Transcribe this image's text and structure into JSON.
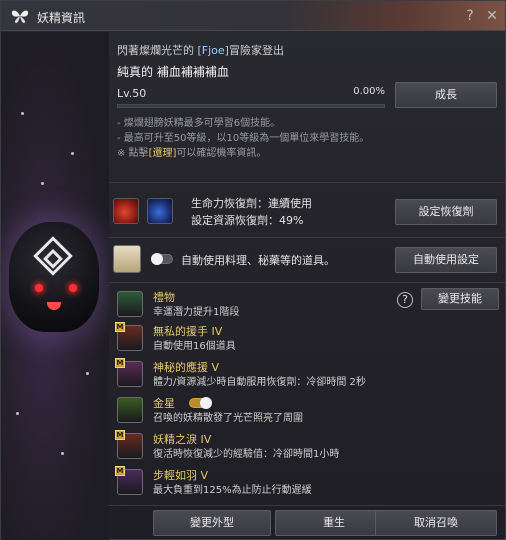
{
  "window": {
    "title": "妖精資訊",
    "help_glyph": "?",
    "close_glyph": "✕"
  },
  "header": {
    "subtitle_prefix": "閃著燦爛光芒的",
    "subtitle_tag": "[Fjoe]",
    "subtitle_suffix": "冒險家登出",
    "fairy_name": "純真的 補血補補補血",
    "level": "Lv.50",
    "exp_percent_text": "0.00%",
    "exp_fraction": 0.0,
    "grow_button": "成長"
  },
  "notes": {
    "n1": "- 燦爛翅膀妖精最多可學習6個技能。",
    "n2": "- 最高可升至50等級，以10等級為一個單位來學習技能。",
    "n3_prefix": "※ 點擊",
    "n3_link": "[還理]",
    "n3_suffix": "可以確認機率資訊。"
  },
  "potion": {
    "line1": "生命力恢復劑：連續使用",
    "line2": "設定資源恢復劑：49%",
    "button": "設定恢復劑"
  },
  "auto_use": {
    "text": "自動使用料理、秘藥等的道具。",
    "toggle_on": false,
    "button": "自動使用設定"
  },
  "skills_section": {
    "help_glyph": "?",
    "change_button": "變更技能"
  },
  "skills": [
    {
      "name": "禮物",
      "desc": "幸運潛力提升1階段",
      "badge": "",
      "icon": "clover-icon",
      "color": "#2f5a3a"
    },
    {
      "name": "無私的援手 IV",
      "desc": "自動使用16個道具",
      "badge": "M",
      "icon": "hand-icon",
      "color": "#6a2a22"
    },
    {
      "name": "神秘的應援 V",
      "desc": "體力/資源減少時自動服用恢復劑：冷卻時間 2秒",
      "badge": "M",
      "icon": "potion-icon",
      "color": "#5a2a55"
    },
    {
      "name": "金星",
      "desc": "召喚的妖精散發了光芒照亮了周圍",
      "badge": "",
      "icon": "lantern-icon",
      "color": "#3a5a22",
      "toggle_on": true
    },
    {
      "name": "妖精之淚 IV",
      "desc": "復活時恢復減少的經驗值：冷卻時間1小時",
      "badge": "M",
      "icon": "tear-icon",
      "color": "#6a2a22"
    },
    {
      "name": "步輕如羽 V",
      "desc": "最大負重到125%為止防止行動遲緩",
      "badge": "M",
      "icon": "bag-icon",
      "color": "#4a2a5a"
    }
  ],
  "bottom": {
    "change_look": "變更外型",
    "rebirth": "重生",
    "cancel_summon": "取消召喚"
  }
}
